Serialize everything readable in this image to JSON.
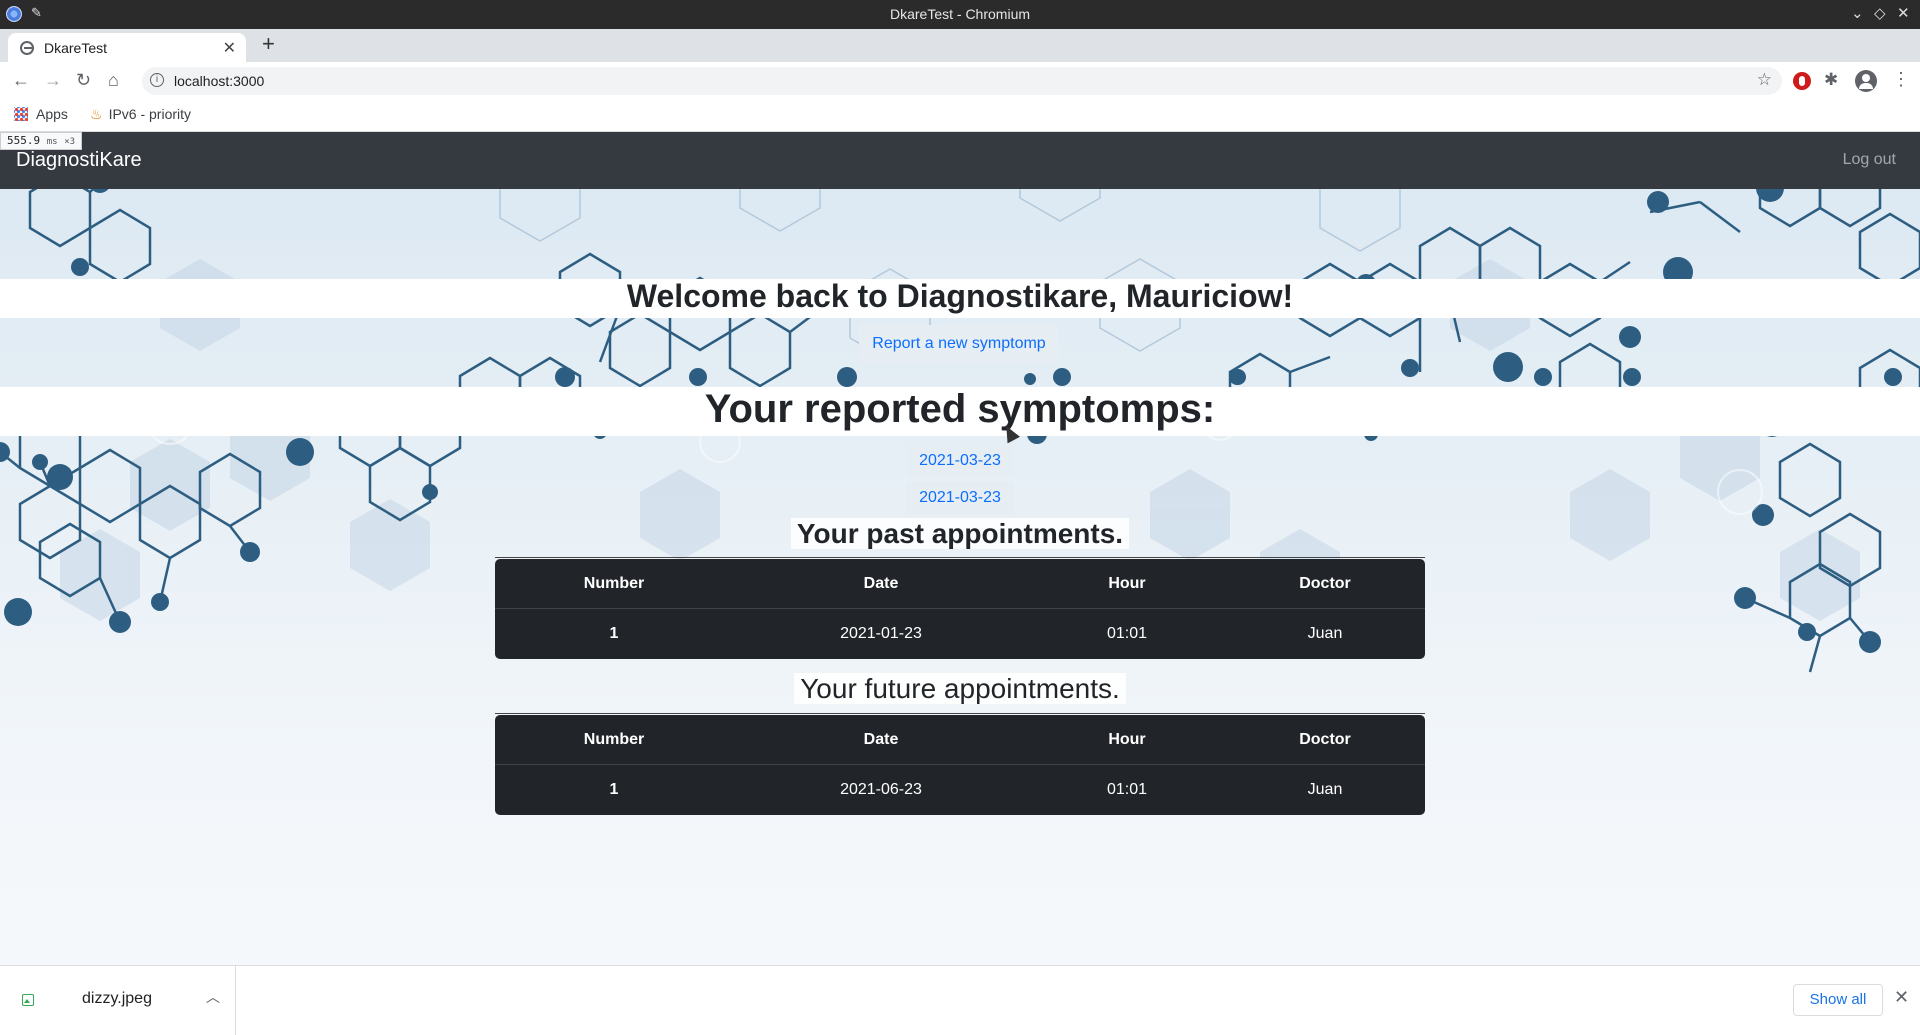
{
  "window": {
    "title": "DkareTest - Chromium"
  },
  "tabs": [
    {
      "title": "DkareTest"
    }
  ],
  "toolbar": {
    "url": "localhost:3000"
  },
  "bookmarks": {
    "items": [
      {
        "label": "Apps"
      },
      {
        "label": "IPv6 - priority"
      }
    ]
  },
  "perf_badge": {
    "value": "555.9",
    "unit": "ms",
    "mult": "×3"
  },
  "site": {
    "brand": "DiagnostiKare",
    "logout": "Log out"
  },
  "welcome": "Welcome back to Diagnostikare, Mauriciow!",
  "report_button": "Report a new symptomp",
  "symptoms": {
    "title": "Your reported symptomps:",
    "items": [
      "2021-03-23",
      "2021-03-23"
    ]
  },
  "past_appointments": {
    "title": "Your past appointments.",
    "headers": [
      "Number",
      "Date",
      "Hour",
      "Doctor"
    ],
    "rows": [
      {
        "number": "1",
        "date": "2021-01-23",
        "hour": "01:01",
        "doctor": "Juan"
      }
    ]
  },
  "future_appointments": {
    "title": "Your future appointments.",
    "headers": [
      "Number",
      "Date",
      "Hour",
      "Doctor"
    ],
    "rows": [
      {
        "number": "1",
        "date": "2021-06-23",
        "hour": "01:01",
        "doctor": "Juan"
      }
    ]
  },
  "downloads": {
    "file": "dizzy.jpeg",
    "show_all": "Show all"
  },
  "colors": {
    "navbar": "#343a40",
    "table": "#212529",
    "link": "#0d6efd",
    "molecule": "#2d5e82"
  }
}
